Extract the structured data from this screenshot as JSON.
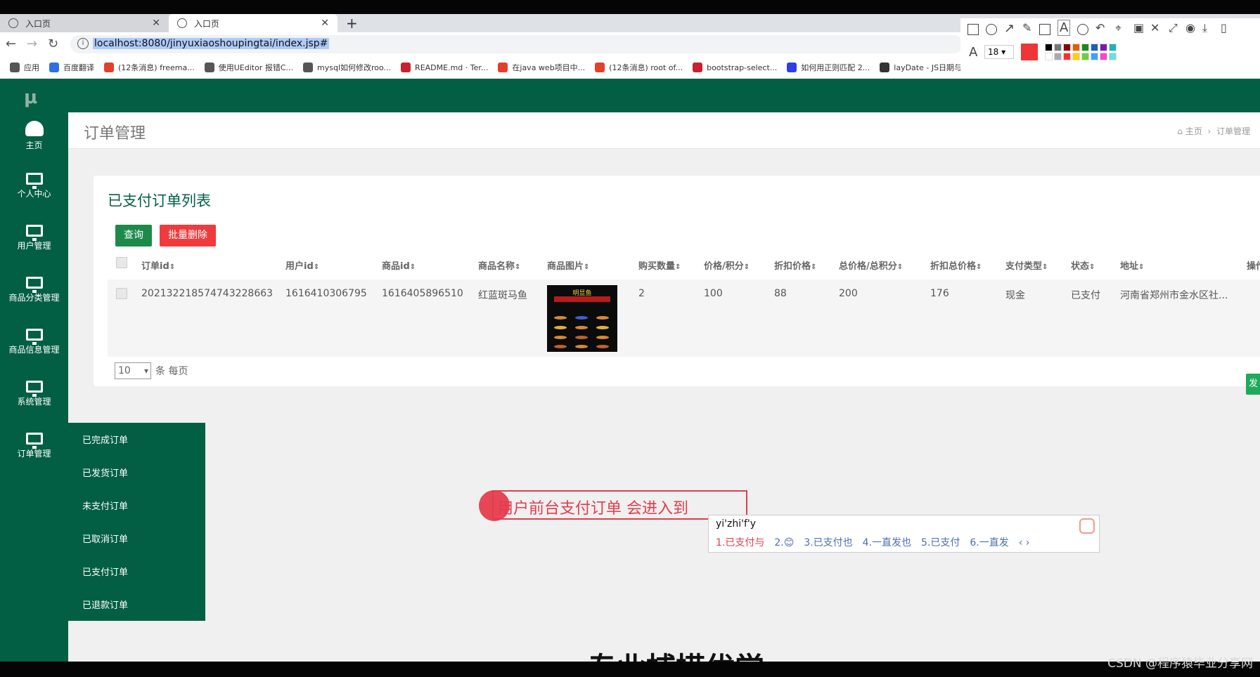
{
  "browser": {
    "tabs": [
      {
        "title": "入口页"
      },
      {
        "title": "入口页"
      }
    ],
    "url": "localhost:8080/jinyuxiaoshoupingtai/index.jsp#",
    "bookmarks": [
      {
        "label": "应用",
        "color": "#555555"
      },
      {
        "label": "百度翻译",
        "color": "#2f6fe0"
      },
      {
        "label": "(12条消息) freema...",
        "color": "#e0412b"
      },
      {
        "label": "使用UEditor 报错C...",
        "color": "#555555"
      },
      {
        "label": "mysql如何修改roo...",
        "color": "#555555"
      },
      {
        "label": "README.md · Ter...",
        "color": "#c4232f"
      },
      {
        "label": "在java web项目中...",
        "color": "#e0412b"
      },
      {
        "label": "(12条消息) root of...",
        "color": "#e0412b"
      },
      {
        "label": "bootstrap-select...",
        "color": "#c4232f"
      },
      {
        "label": "如何用正则匹配 2...",
        "color": "#2f3fe0"
      },
      {
        "label": "layDate - JS日期与...",
        "color": "#333333"
      }
    ],
    "annot_font_size": "18",
    "annot_swatches": [
      "#000000",
      "#777777",
      "#8b0000",
      "#e06000",
      "#1a8a1a",
      "#1a5fbf",
      "#7a1ab5",
      "#1ab5b5",
      "#ffffff",
      "#aaaaaa",
      "#ff3030",
      "#ffd000",
      "#6bd13a",
      "#35a5ff",
      "#ff44cc",
      "#66e0e0"
    ],
    "annot_color": "#ef3535"
  },
  "app": {
    "brand_colors": {
      "primary": "#035f43",
      "query_button": "#1e8a4a",
      "delete_button": "#ef3b3b"
    },
    "logo": "μ",
    "sidebar": [
      {
        "label": "主页",
        "icon": "dashboard-icon"
      },
      {
        "label": "个人中心",
        "icon": "monitor-icon"
      },
      {
        "label": "用户管理",
        "icon": "monitor-icon"
      },
      {
        "label": "商品分类管理",
        "icon": "monitor-icon"
      },
      {
        "label": "商品信息管理",
        "icon": "monitor-icon"
      },
      {
        "label": "系统管理",
        "icon": "monitor-icon"
      },
      {
        "label": "订单管理",
        "icon": "monitor-icon"
      }
    ],
    "submenu": [
      "已完成订单",
      "已发货订单",
      "未支付订单",
      "已取消订单",
      "已支付订单",
      "已退款订单"
    ],
    "page_title": "订单管理",
    "breadcrumb": {
      "home": "主页",
      "sep": "›",
      "current": "订单管理"
    },
    "card_title": "已支付订单列表",
    "buttons": {
      "query": "查询",
      "batch_delete": "批量删除"
    },
    "columns": [
      "订单id",
      "用户id",
      "商品id",
      "商品名称",
      "商品图片",
      "购买数量",
      "价格/积分",
      "折扣价格",
      "总价格/总积分",
      "折扣总价格",
      "支付类型",
      "状态",
      "地址",
      "操作"
    ],
    "rows": [
      {
        "order_id": "2021322185747432286​63",
        "user_id": "1616410306795",
        "goods_id": "1616405896510",
        "goods_name": "红蓝斑马鱼",
        "qty": "2",
        "price": "100",
        "discount": "88",
        "total": "200",
        "discount_total": "176",
        "pay_type": "现金",
        "status": "已支付",
        "address": "河南省郑州市金水区社..."
      }
    ],
    "goods_image_caption": "明显鱼",
    "page_size": "10",
    "page_size_suffix": "条 每页",
    "edge_button_label": "发"
  },
  "overlay": {
    "annotation_text": "用户前台支付订单  会进入到",
    "ime_input": "yi'zhi'f'y",
    "ime_candidates": [
      "1.已支付与",
      "2.😊",
      "3.已支付也",
      "4.一直发也",
      "5.已支付",
      "6.一直发"
    ],
    "ime_more": "‹ ›",
    "bottom_text": "专业捕捞优学",
    "watermark": "CSDN @程序猿毕业分享网"
  }
}
